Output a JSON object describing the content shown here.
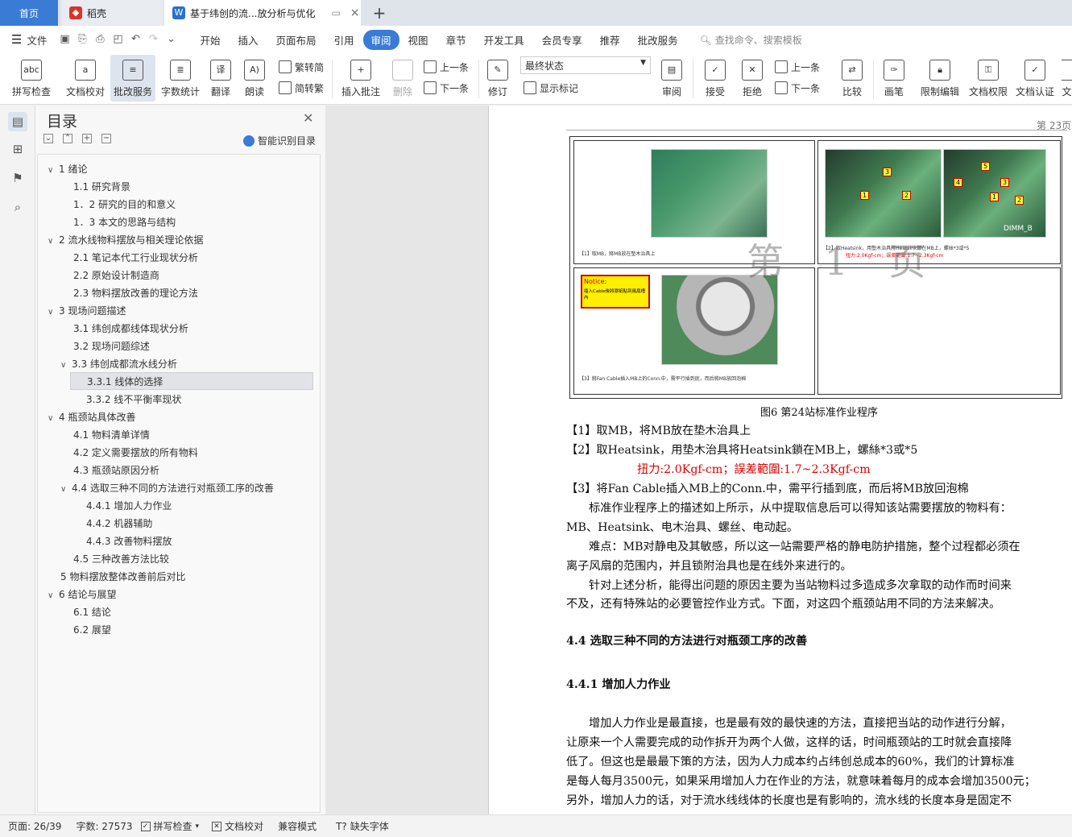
{
  "tabs": {
    "home": "首页",
    "daoke": "稻壳",
    "doc": "基于纬创的流...放分析与优化"
  },
  "menu": {
    "file": "文件",
    "items": [
      "开始",
      "插入",
      "页面布局",
      "引用",
      "审阅",
      "视图",
      "章节",
      "开发工具",
      "会员专享",
      "推荐",
      "批改服务"
    ],
    "active": "审阅",
    "search": "查找命令、搜索模板"
  },
  "ribbon": {
    "spell": "拼写检查",
    "proof": "文档校对",
    "revise_service": "批改服务",
    "wordcount": "字数统计",
    "translate": "翻译",
    "read": "朗读",
    "to_trad": "繁转简",
    "to_simp": "简转繁",
    "insert_comment": "插入批注",
    "delete": "删除",
    "prev": "上一条",
    "next": "下一条",
    "track": "修订",
    "state": "最终状态",
    "show_marks": "显示标记",
    "review": "审阅",
    "accept": "接受",
    "reject": "拒绝",
    "prev2": "上一条",
    "next2": "下一条",
    "compare": "比较",
    "pen": "画笔",
    "restrict": "限制编辑",
    "doc_rights": "文档权限",
    "doc_auth": "文档认证",
    "more": "文"
  },
  "toc": {
    "title": "目录",
    "smart": "智能识别目录",
    "items": [
      {
        "text": "1  绪论"
      },
      {
        "text": "1.1 研究背景"
      },
      {
        "text": "1．2 研究的目的和意义"
      },
      {
        "text": "1．3 本文的思路与结构"
      },
      {
        "text": "2  流水线物料摆放与相关理论依据"
      },
      {
        "text": "2.1 笔记本代工行业现状分析"
      },
      {
        "text": "2.2 原始设计制造商"
      },
      {
        "text": "2.3 物料摆放改善的理论方法"
      },
      {
        "text": "3 现场问题描述"
      },
      {
        "text": "3.1 纬创成都线体现状分析"
      },
      {
        "text": "3.2 现场问题综述"
      },
      {
        "text": "3.3 纬创成都流水线分析"
      },
      {
        "text": "3.3.1 线体的选择"
      },
      {
        "text": "3.3.2 线不平衡率现状"
      },
      {
        "text": "4 瓶颈站具体改善"
      },
      {
        "text": "4.1 物料清单详情"
      },
      {
        "text": "4.2 定义需要摆放的所有物料"
      },
      {
        "text": "4.3 瓶颈站原因分析"
      },
      {
        "text": "4.4 选取三种不同的方法进行对瓶颈工序的改善"
      },
      {
        "text": "4.4.1 增加人力作业"
      },
      {
        "text": "4.4.2 机器辅助"
      },
      {
        "text": "4.4.3 改善物料摆放"
      },
      {
        "text": "4.5 三种改善方法比较"
      },
      {
        "text": "5  物料摆放整体改善前后对比"
      },
      {
        "text": "6  结论与展望"
      },
      {
        "text": "6.1 结论"
      },
      {
        "text": "6.2 展望"
      }
    ]
  },
  "page": {
    "number": "第 23页",
    "watermark": "第 1 页",
    "fig_caption1": "【1】取MB，將MB放在墊木治具上",
    "fig_caption2a": "【2】取Heatsink，用墊木治具將Heatsink鎖在MB上，螺絲*3或*5",
    "fig_caption2b": "扭力:2.0Kgf-cm；誤差範圍:1.7~2.3Kgf-cm",
    "fig_caption3": "【3】將Fan Cable插入MB上的Conn.中，需平行插到底，而后將MB放回泡棉",
    "dimm": "DIMM_B",
    "notice_title": "Notice:",
    "notice_body": "插入Cable後將膠紙貼到風扇槽內",
    "figure_title": "图6    第24站标准作业程序",
    "step1": "【1】取MB，将MB放在垫木治具上",
    "step2": "【2】取Heatsink，用垫木治具将Heatsink鎖在MB上，螺絲*3或*5",
    "step2_torque": "扭力:2.0Kgf-cm；誤差範圍:1.7~2.3Kgf-cm",
    "step3": "【3】将Fan Cable插入MB上的Conn.中，需平行插到底，而后将MB放回泡棉",
    "para1a": "标准作业程序上的描述如上所示，从中提取信息后可以得知该站需要摆放的物料有：",
    "para1b": "MB、Heatsink、电木治具、螺丝、电动起。",
    "para2a": "难点：MB对静电及其敏感，所以这一站需要严格的静电防护措施，整个过程都必须在",
    "para2b": "离子风扇的范围内，并且锁附治具也是在线外来进行的。",
    "para3a": "针对上述分析，能得出问题的原因主要为当站物料过多造成多次拿取的动作而时间来",
    "para3b": "不及，还有特殊站的必要管控作业方式。下面，对这四个瓶颈站用不同的方法来解决。",
    "h44": "4.4 选取三种不同的方法进行对瓶颈工序的改善",
    "h441": "4.4.1 增加人力作业",
    "para4a": "增加人力作业是最直接，也是最有效的最快速的方法，直接把当站的动作进行分解，",
    "para4b": "让原来一个人需要完成的动作拆开为两个人做，这样的话，时间瓶颈站的工时就会直接降",
    "para4c": "低了。但这也是最最下策的方法，因为人力成本约占纬创总成本的60%，我们的计算标准",
    "para4d": "是每人每月3500元，如果采用增加人力在作业的方法，就意味着每月的成本会增加3500元；",
    "para4e": "另外，增加人力的话，对于流水线线体的长度也是有影响的，流水线的长度本身是固定不"
  },
  "status": {
    "page": "页面: 26/39",
    "words": "字数: 27573",
    "spell": "拼写检查",
    "proof": "文档校对",
    "compat": "兼容模式",
    "missing_font": "缺失字体"
  },
  "colors": {
    "accent": "#3a7bd5",
    "red_text": "#d00000"
  }
}
